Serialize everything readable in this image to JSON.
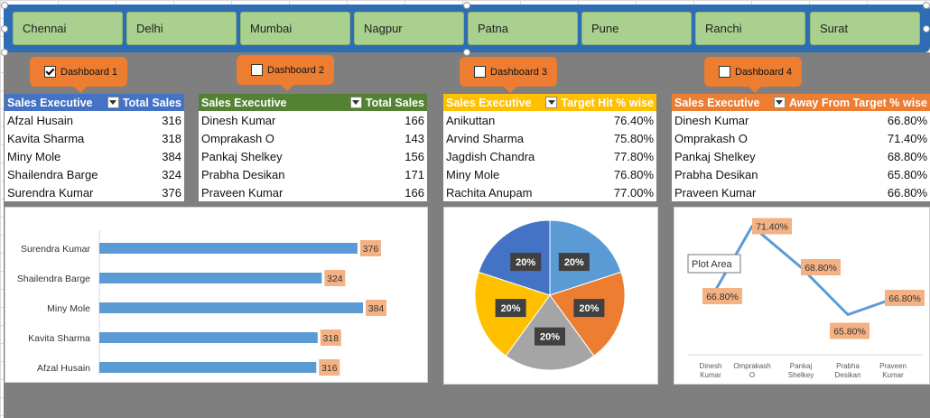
{
  "slicer": {
    "items": [
      {
        "label": "Chennai",
        "selected": true
      },
      {
        "label": "Delhi",
        "selected": false
      },
      {
        "label": "Mumbai",
        "selected": false
      },
      {
        "label": "Nagpur",
        "selected": false
      },
      {
        "label": "Patna",
        "selected": false
      },
      {
        "label": "Pune",
        "selected": false
      },
      {
        "label": "Ranchi",
        "selected": false
      },
      {
        "label": "Surat",
        "selected": false
      }
    ]
  },
  "dashboards": [
    {
      "label": "Dashboard 1",
      "checked": true
    },
    {
      "label": "Dashboard 2",
      "checked": false
    },
    {
      "label": "Dashboard 3",
      "checked": false
    },
    {
      "label": "Dashboard 4",
      "checked": false
    }
  ],
  "colors": {
    "slicer_bg": "#2e6db4",
    "slicer_item": "#a9d08e",
    "slicer_selected": "#f4b183",
    "table1_header": "#4472c4",
    "table2_header": "#548235",
    "table3_header": "#ffc000",
    "table4_header": "#ed7d31",
    "bar": "#5b9bd5",
    "label_bg": "#f4b183"
  },
  "tables": [
    {
      "col1": "Sales Executive",
      "col2": "Total Sales",
      "rows": [
        {
          "name": "Afzal Husain",
          "value": "316"
        },
        {
          "name": "Kavita Sharma",
          "value": "318"
        },
        {
          "name": "Miny Mole",
          "value": "384"
        },
        {
          "name": "Shailendra Barge",
          "value": "324"
        },
        {
          "name": "Surendra Kumar",
          "value": "376"
        }
      ]
    },
    {
      "col1": "Sales Executive",
      "col2": "Total Sales",
      "rows": [
        {
          "name": "Dinesh Kumar",
          "value": "166"
        },
        {
          "name": "Omprakash O",
          "value": "143"
        },
        {
          "name": "Pankaj Shelkey",
          "value": "156"
        },
        {
          "name": "Prabha Desikan",
          "value": "171"
        },
        {
          "name": "Praveen Kumar",
          "value": "166"
        }
      ]
    },
    {
      "col1": "Sales Executive",
      "col2": "Target Hit % wise",
      "rows": [
        {
          "name": "Anikuttan",
          "value": "76.40%"
        },
        {
          "name": "Arvind Sharma",
          "value": "75.80%"
        },
        {
          "name": "Jagdish Chandra",
          "value": "77.80%"
        },
        {
          "name": "Miny Mole",
          "value": "76.80%"
        },
        {
          "name": "Rachita Anupam",
          "value": "77.00%"
        }
      ]
    },
    {
      "col1": "Sales Executive",
      "col2": "Away From Target % wise",
      "rows": [
        {
          "name": "Dinesh Kumar",
          "value": "66.80%"
        },
        {
          "name": "Omprakash O",
          "value": "71.40%"
        },
        {
          "name": "Pankaj Shelkey",
          "value": "68.80%"
        },
        {
          "name": "Prabha Desikan",
          "value": "65.80%"
        },
        {
          "name": "Praveen Kumar",
          "value": "66.80%"
        }
      ]
    }
  ],
  "chart_data": [
    {
      "type": "bar",
      "orientation": "horizontal",
      "categories": [
        "Surendra Kumar",
        "Shailendra Barge",
        "Miny Mole",
        "Kavita Sharma",
        "Afzal Husain"
      ],
      "values": [
        376,
        324,
        384,
        318,
        316
      ],
      "data_labels": [
        "376",
        "324",
        "384",
        "318",
        "316"
      ],
      "title": "",
      "xlabel": "",
      "ylabel": "",
      "xlim": [
        0,
        400
      ],
      "grid": false
    },
    {
      "type": "pie",
      "categories": [
        "Anikuttan",
        "Arvind Sharma",
        "Jagdish Chandra",
        "Miny Mole",
        "Rachita Anupam"
      ],
      "values": [
        20,
        20,
        20,
        20,
        20
      ],
      "data_labels": [
        "20%",
        "20%",
        "20%",
        "20%",
        "20%"
      ],
      "colors": [
        "#5b9bd5",
        "#ed7d31",
        "#a5a5a5",
        "#ffc000",
        "#4472c4"
      ],
      "title": ""
    },
    {
      "type": "line",
      "categories": [
        "Dinesh Kumar",
        "Omprakash O",
        "Pankaj Shelkey",
        "Prabha Desikan",
        "Praveen Kumar"
      ],
      "values": [
        66.8,
        71.4,
        68.8,
        65.8,
        66.8
      ],
      "data_labels": [
        "66.80%",
        "71.40%",
        "68.80%",
        "65.80%",
        "66.80%"
      ],
      "ylim": [
        64,
        72
      ],
      "title": "",
      "xlabel": "",
      "ylabel": "",
      "tooltip": "Plot Area"
    }
  ]
}
